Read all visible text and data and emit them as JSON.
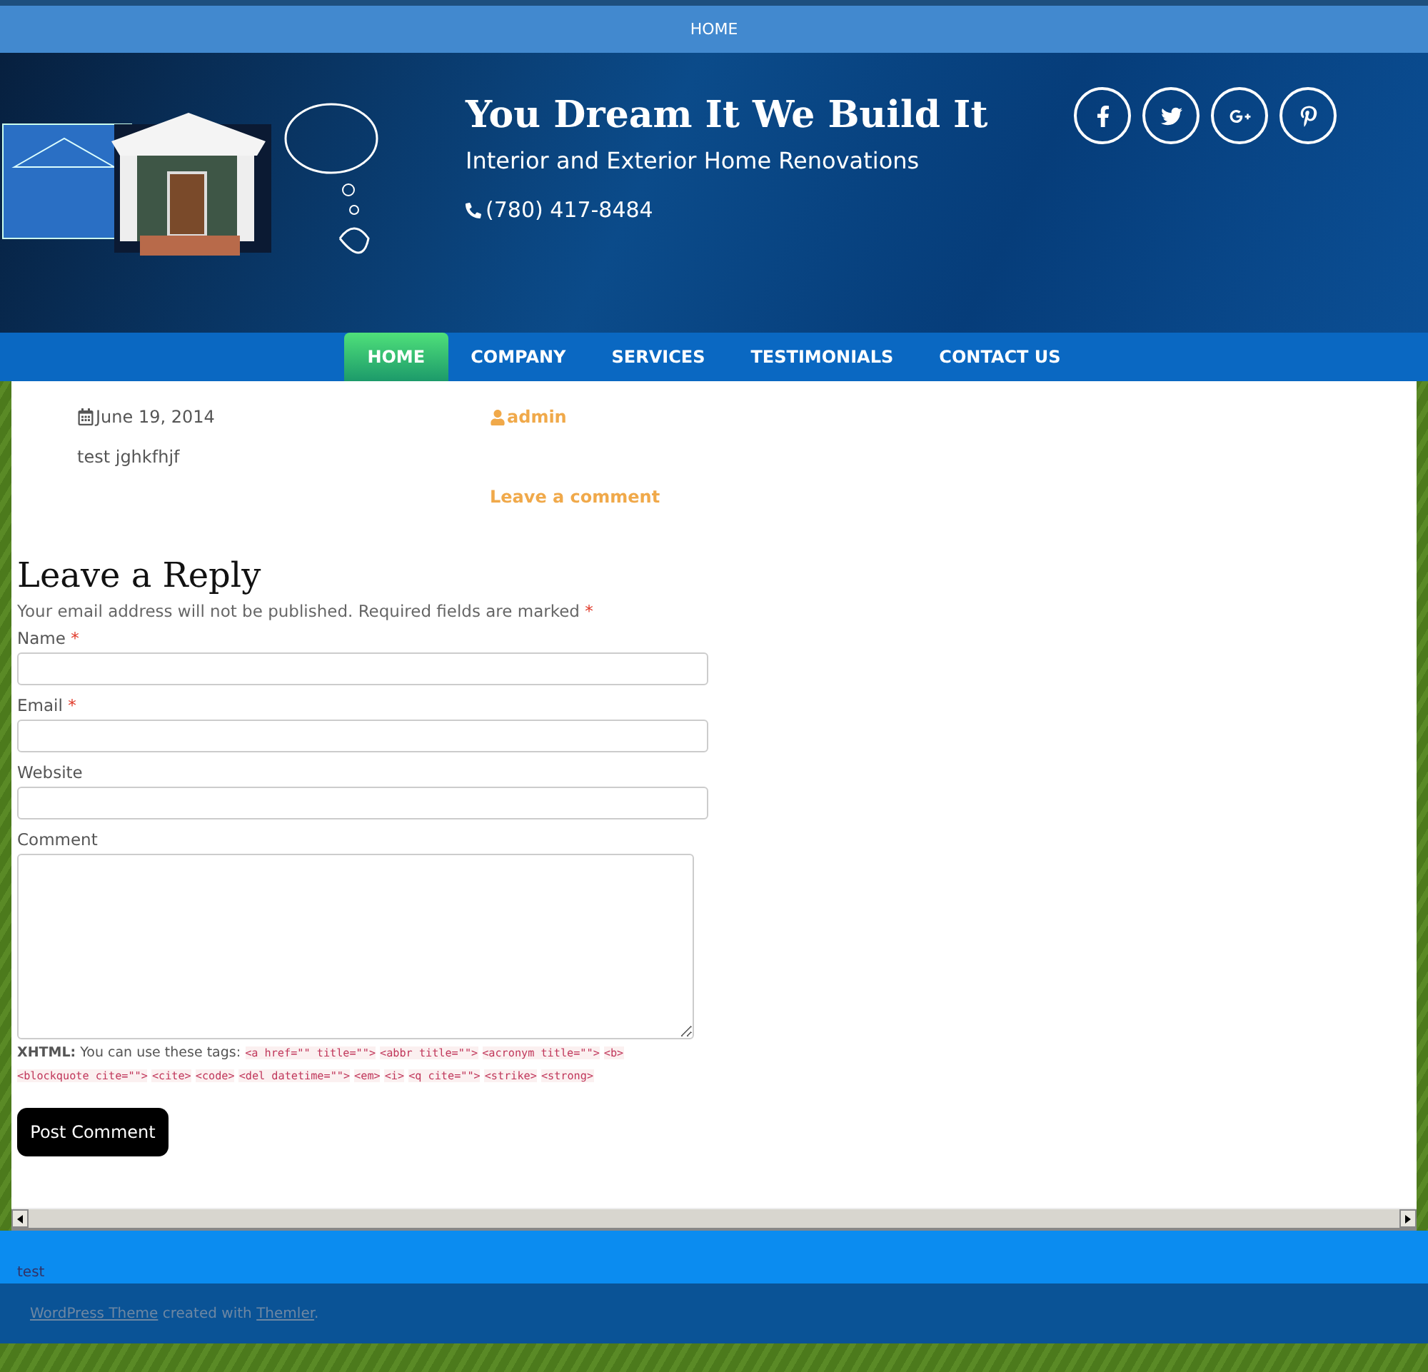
{
  "top_menu": [
    {
      "label": "HOME",
      "selected": true
    }
  ],
  "header": {
    "title": "You Dream It We Build It",
    "slogan": "Interior and Exterior Home Renovations",
    "phone": "(780) 417-8484",
    "social": [
      {
        "kind": "facebook"
      },
      {
        "kind": "twitter"
      },
      {
        "kind": "googleplus"
      },
      {
        "kind": "pinterest"
      }
    ]
  },
  "nav": [
    {
      "label": "HOME",
      "selected": true
    },
    {
      "label": "COMPANY",
      "selected": false
    },
    {
      "label": "SERVICES",
      "selected": false
    },
    {
      "label": "TESTIMONIALS",
      "selected": false
    },
    {
      "label": "CONTACT US",
      "selected": false
    }
  ],
  "post": {
    "date": "June 19, 2014",
    "author": "admin",
    "body": "test jghkfhjf",
    "comment_link": "Leave a comment"
  },
  "reply": {
    "title": "Leave a Reply",
    "note": "Your email address will not be published. Required fields are marked",
    "required_mark": "*",
    "fields": [
      {
        "label": "Name",
        "required": true,
        "kind": "input"
      },
      {
        "label": "Email",
        "required": true,
        "kind": "input"
      },
      {
        "label": "Website",
        "required": false,
        "kind": "input"
      },
      {
        "label": "Comment",
        "required": false,
        "kind": "textarea"
      }
    ],
    "tags_label": "XHTML:",
    "tags_intro": "You can use these tags:",
    "tags": [
      "<a href=\"\" title=\"\">",
      "<abbr title=\"\">",
      "<acronym title=\"\">",
      "<b>",
      "<blockquote cite=\"\">",
      "<cite>",
      "<code>",
      "<del datetime=\"\">",
      "<em>",
      "<i>",
      "<q cite=\"\">",
      "<strike>",
      "<strong>"
    ],
    "submit": "Post Comment"
  },
  "footer": {
    "text": "test",
    "credit_link": "WordPress Theme",
    "credit_middle": "created with",
    "credit_link2": "Themler",
    "credit_end": "."
  }
}
